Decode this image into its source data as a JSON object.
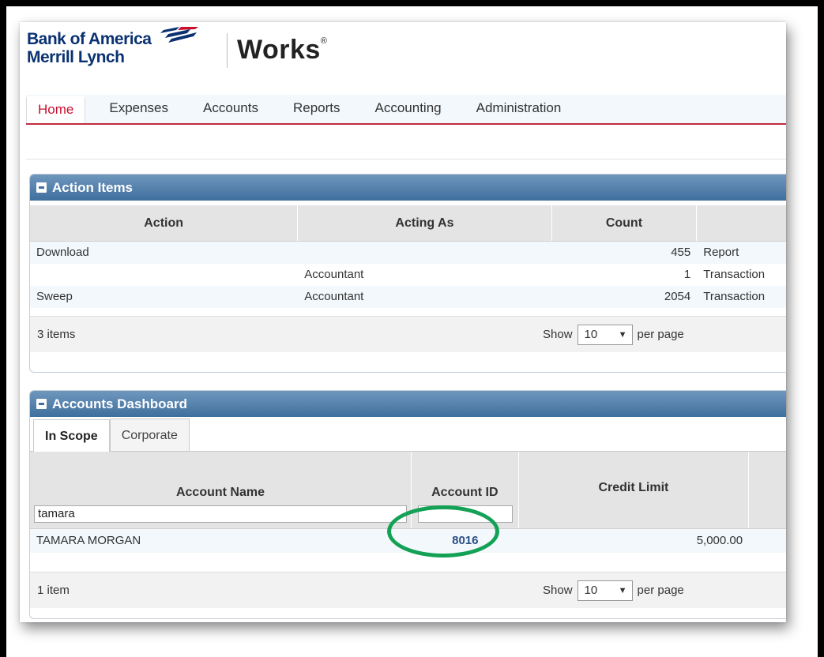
{
  "logo": {
    "brand_line1": "Bank of America",
    "brand_line2": "Merrill Lynch",
    "product": "Works",
    "reg_mark": "®",
    "brand_color": "#0a3172"
  },
  "nav": {
    "items": [
      {
        "label": "Home",
        "active": true
      },
      {
        "label": "Expenses"
      },
      {
        "label": "Accounts"
      },
      {
        "label": "Reports"
      },
      {
        "label": "Accounting"
      },
      {
        "label": "Administration"
      }
    ],
    "accent_color": "#c8102e"
  },
  "action_items": {
    "title": "Action Items",
    "columns": [
      "Action",
      "Acting As",
      "Count",
      ""
    ],
    "rows": [
      {
        "action": "Download",
        "acting_as": "",
        "count": "455",
        "type": "Report"
      },
      {
        "action": "",
        "acting_as": "Accountant",
        "count": "1",
        "type": "Transaction"
      },
      {
        "action": "Sweep",
        "acting_as": "Accountant",
        "count": "2054",
        "type": "Transaction"
      }
    ],
    "pager": {
      "count_text": "3 items",
      "show_label": "Show",
      "per_page_value": "10",
      "per_page_label": "per page"
    }
  },
  "accounts_dashboard": {
    "title": "Accounts Dashboard",
    "tabs": [
      {
        "label": "In Scope",
        "active": true
      },
      {
        "label": "Corporate"
      }
    ],
    "columns": [
      "Account Name",
      "Account ID",
      "Credit Limit",
      ""
    ],
    "filters": {
      "account_name": "tamara",
      "account_id": ""
    },
    "rows": [
      {
        "account_name": "TAMARA MORGAN",
        "account_id": "8016",
        "credit_limit": "5,000.00"
      }
    ],
    "pager": {
      "count_text": "1 item",
      "show_label": "Show",
      "per_page_value": "10",
      "per_page_label": "per page"
    }
  },
  "annotation": {
    "ring_color": "#13a155"
  }
}
